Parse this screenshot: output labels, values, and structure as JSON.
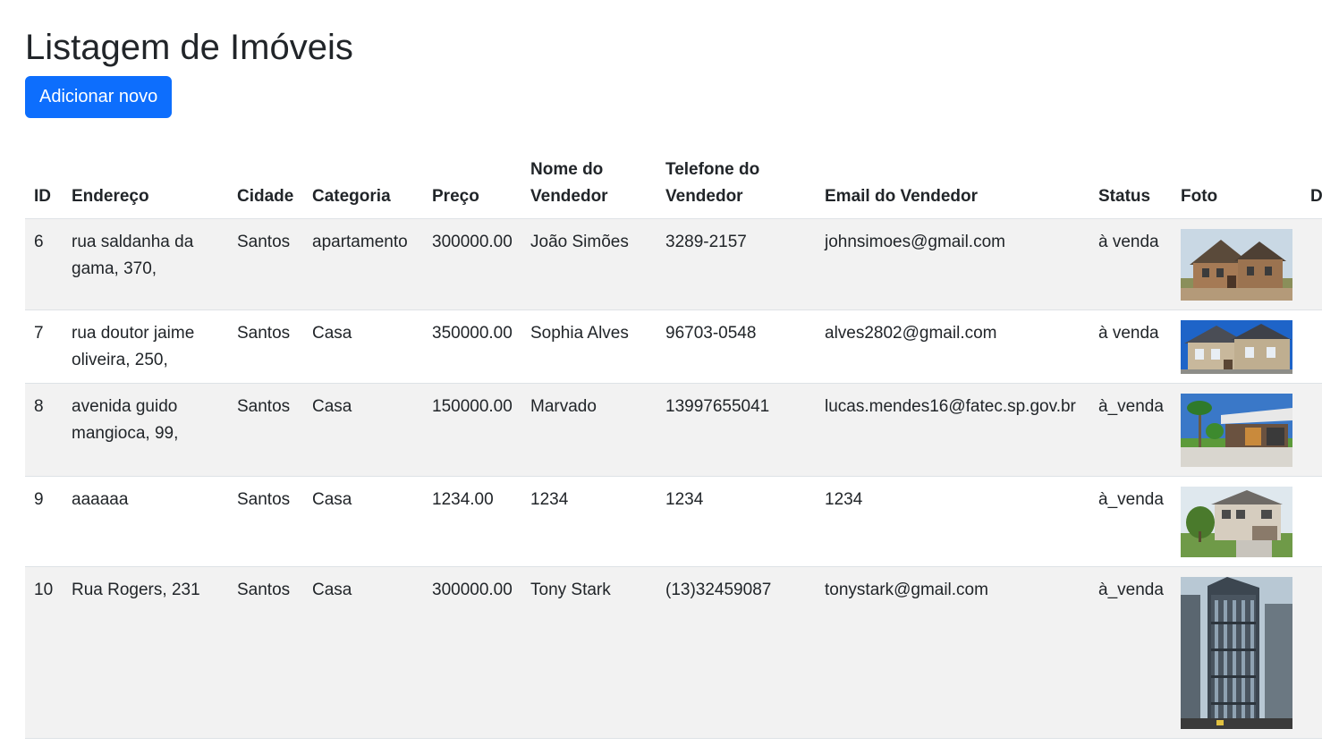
{
  "page": {
    "title": "Listagem de Imóveis",
    "add_button": "Adicionar novo"
  },
  "table": {
    "headers": {
      "id": "ID",
      "endereco": "Endereço",
      "cidade": "Cidade",
      "categoria": "Categoria",
      "preco": "Preço",
      "nome": "Nome do Vendedor",
      "telefone": "Telefone do Vendedor",
      "email": "Email do Vendedor",
      "status": "Status",
      "foto": "Foto",
      "extra": "D"
    },
    "rows": [
      {
        "id": "6",
        "endereco": "rua saldanha da gama, 370,",
        "cidade": "Santos",
        "categoria": "apartamento",
        "preco": "300000.00",
        "nome": "João Simões",
        "telefone": "3289-2157",
        "email": "johnsimoes@gmail.com",
        "status": "à venda",
        "foto": "house-photo-brick"
      },
      {
        "id": "7",
        "endereco": "rua doutor jaime oliveira, 250,",
        "cidade": "Santos",
        "categoria": "Casa",
        "preco": "350000.00",
        "nome": "Sophia Alves",
        "telefone": "96703-0548",
        "email": "alves2802@gmail.com",
        "status": "à venda",
        "foto": "house-photo-blue-sky"
      },
      {
        "id": "8",
        "endereco": "avenida guido mangioca, 99,",
        "cidade": "Santos",
        "categoria": "Casa",
        "preco": "150000.00",
        "nome": "Marvado",
        "telefone": "13997655041",
        "email": "lucas.mendes16@fatec.sp.gov.br",
        "status": "à_venda",
        "foto": "house-photo-modern"
      },
      {
        "id": "9",
        "endereco": "aaaaaa",
        "cidade": "Santos",
        "categoria": "Casa",
        "preco": "1234.00",
        "nome": "1234",
        "telefone": "1234",
        "email": "1234",
        "status": "à_venda",
        "foto": "house-photo-suburban"
      },
      {
        "id": "10",
        "endereco": "Rua Rogers, 231",
        "cidade": "Santos",
        "categoria": "Casa",
        "preco": "300000.00",
        "nome": "Tony Stark",
        "telefone": "(13)32459087",
        "email": "tonystark@gmail.com",
        "status": "à_venda",
        "foto": "building-photo-skyscraper"
      }
    ]
  },
  "colors": {
    "primary": "#0d6efd",
    "stripe": "#f2f2f2",
    "border": "#dee2e6",
    "text": "#212529"
  }
}
